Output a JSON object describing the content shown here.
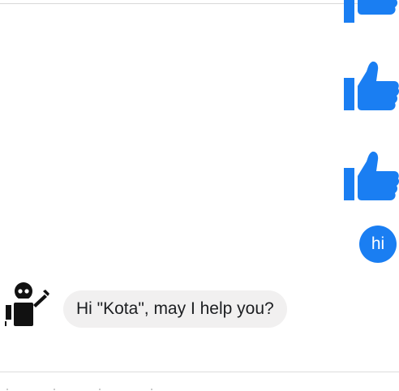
{
  "conversation": {
    "messages": [
      {
        "sender": "user",
        "type": "sticker",
        "icon": "thumbs-up-icon",
        "partial": true
      },
      {
        "sender": "user",
        "type": "sticker",
        "icon": "thumbs-up-icon"
      },
      {
        "sender": "user",
        "type": "sticker",
        "icon": "thumbs-up-icon"
      },
      {
        "sender": "user",
        "type": "text",
        "text": "hi"
      },
      {
        "sender": "bot",
        "type": "text",
        "avatar_icon": "robot-icon",
        "text": "Hi \"Kota\", may I help you?"
      }
    ]
  },
  "colors": {
    "accent": "#1a7ef2",
    "bot_bubble": "#f1f0f0",
    "text": "#1c1e21"
  }
}
